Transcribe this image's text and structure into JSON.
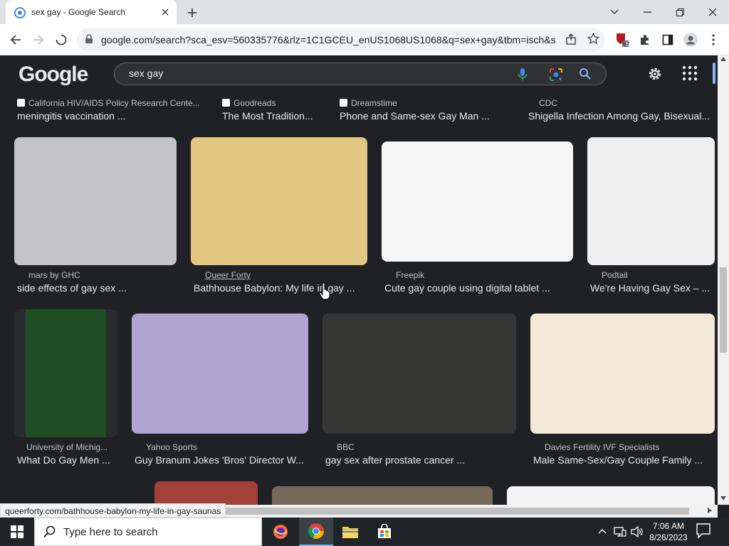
{
  "browser": {
    "tab_title": "sex gay - Google Search",
    "url": "google.com/search?sca_esv=560335776&rlz=1C1GCEU_enUS1068US1068&q=sex+gay&tbm=isch&s...",
    "extension_badge": "5"
  },
  "google": {
    "logo": "Google",
    "query": "sex gay"
  },
  "top_row": [
    {
      "source": "California HIV/AIDS Policy Research Cente...",
      "caption": "meningitis vaccination ..."
    },
    {
      "source": "Goodreads",
      "caption": "The Most Tradition..."
    },
    {
      "source": "Dreamstime",
      "caption": "Phone and Same-sex Gay Man ..."
    },
    {
      "source": "CDC",
      "caption": "Shigella Infection Among Gay, Bisexual..."
    }
  ],
  "row2": [
    {
      "source": "mars by GHC",
      "caption": "side effects of gay sex ...",
      "color": "#c4c4c6"
    },
    {
      "source": "Queer Forty",
      "caption": "Bathhouse Babylon: My life in gay ...",
      "color": "#e2c781"
    },
    {
      "source": "Freepik",
      "caption": "Cute gay couple using digital tablet ...",
      "color": "#f6f6f6"
    },
    {
      "source": "Podtail",
      "caption": "We're Having Gay Sex – ...",
      "color": "#efefef"
    }
  ],
  "row3": [
    {
      "source": "University of Michig...",
      "caption": "What Do Gay Men ...",
      "color": "#1f4d24"
    },
    {
      "source": "Yahoo Sports",
      "caption": "Guy Branum Jokes 'Bros' Director W...",
      "color": "#b1a3d2"
    },
    {
      "source": "BBC",
      "caption": "gay sex after prostate cancer ...",
      "color": "#363735"
    },
    {
      "source": "Davies Fertility IVF Specialists",
      "caption": "Male Same-Sex/Gay Couple Family ...",
      "color": "#f3e9d8"
    }
  ],
  "row4_colors": [
    "#a2403a",
    "#75695a",
    "#f4f4f4"
  ],
  "status_url": "queerforty.com/bathhouse-babylon-my-life-in-gay-saunas",
  "taskbar": {
    "search_placeholder": "Type here to search",
    "time": "7:06 AM",
    "date": "8/26/2023"
  }
}
